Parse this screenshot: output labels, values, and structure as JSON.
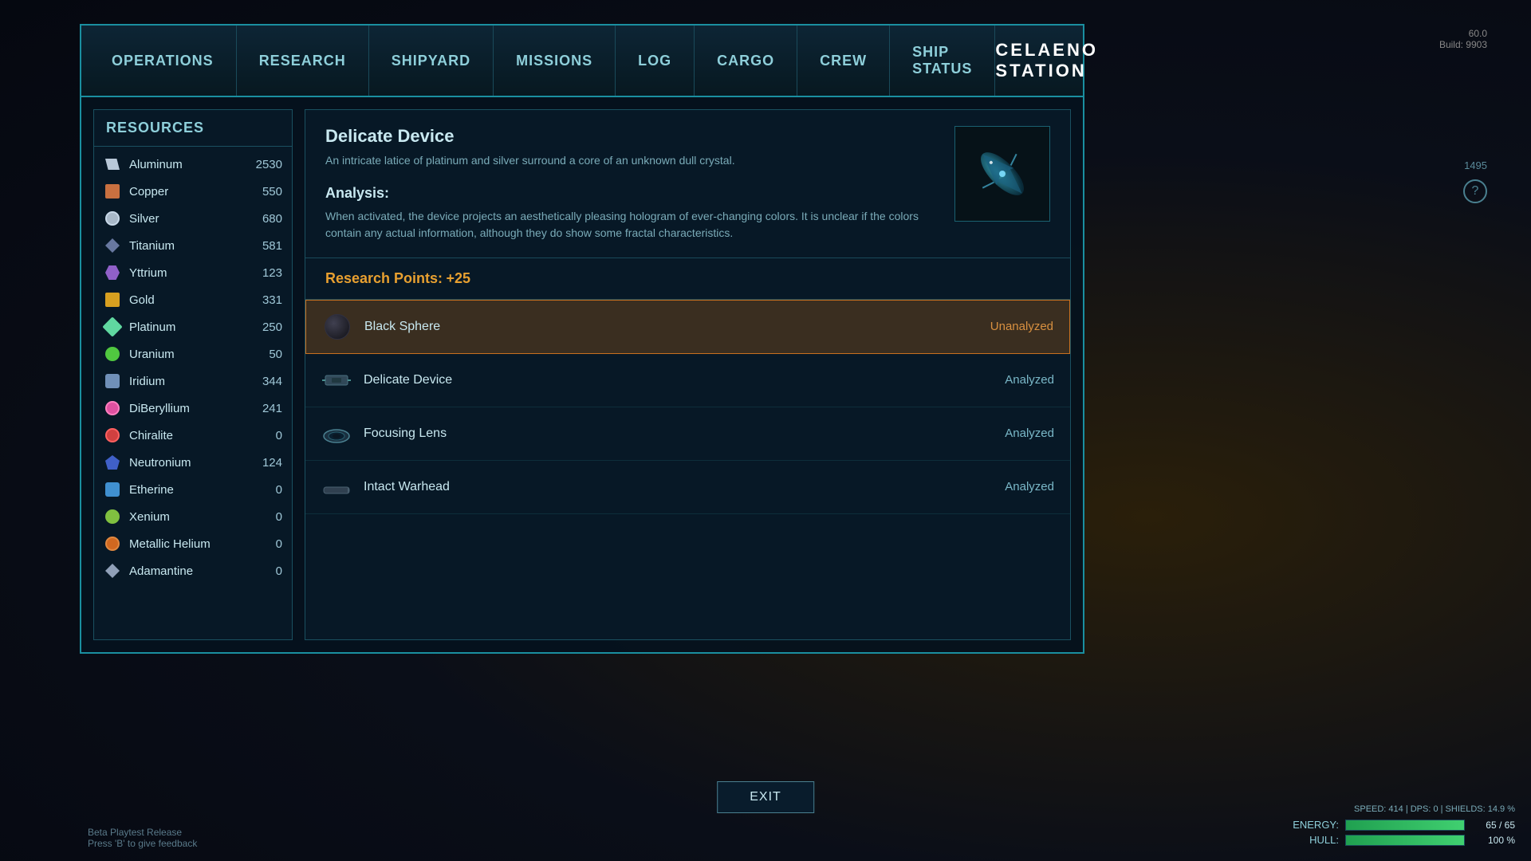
{
  "topStats": {
    "fps": "60.0",
    "build": "Build: 9903"
  },
  "nav": {
    "tabs": [
      {
        "id": "operations",
        "label": "Operations",
        "active": false
      },
      {
        "id": "research",
        "label": "Research",
        "active": false
      },
      {
        "id": "shipyard",
        "label": "Shipyard",
        "active": false
      },
      {
        "id": "missions",
        "label": "Missions",
        "active": false
      },
      {
        "id": "log",
        "label": "Log",
        "active": false
      },
      {
        "id": "cargo",
        "label": "Cargo",
        "active": false
      },
      {
        "id": "crew",
        "label": "Crew",
        "active": false
      },
      {
        "id": "ship-status",
        "label": "Ship Status",
        "active": false
      }
    ],
    "stationTitle": "CELAENO STATION"
  },
  "resources": {
    "title": "Resources",
    "items": [
      {
        "id": "aluminum",
        "name": "Aluminum",
        "amount": "2530",
        "iconClass": "icon-aluminum"
      },
      {
        "id": "copper",
        "name": "Copper",
        "amount": "550",
        "iconClass": "icon-copper"
      },
      {
        "id": "silver",
        "name": "Silver",
        "amount": "680",
        "iconClass": "icon-silver"
      },
      {
        "id": "titanium",
        "name": "Titanium",
        "amount": "581",
        "iconClass": "icon-titanium"
      },
      {
        "id": "yttrium",
        "name": "Yttrium",
        "amount": "123",
        "iconClass": "icon-yttrium"
      },
      {
        "id": "gold",
        "name": "Gold",
        "amount": "331",
        "iconClass": "icon-gold"
      },
      {
        "id": "platinum",
        "name": "Platinum",
        "amount": "250",
        "iconClass": "icon-platinum"
      },
      {
        "id": "uranium",
        "name": "Uranium",
        "amount": "50",
        "iconClass": "icon-uranium"
      },
      {
        "id": "iridium",
        "name": "Iridium",
        "amount": "344",
        "iconClass": "icon-iridium"
      },
      {
        "id": "diberyllium",
        "name": "DiBeryllium",
        "amount": "241",
        "iconClass": "icon-diberyllium"
      },
      {
        "id": "chiralite",
        "name": "Chiralite",
        "amount": "0",
        "iconClass": "icon-chiralite"
      },
      {
        "id": "neutronium",
        "name": "Neutronium",
        "amount": "124",
        "iconClass": "icon-neutronium"
      },
      {
        "id": "etherine",
        "name": "Etherine",
        "amount": "0",
        "iconClass": "icon-etherine"
      },
      {
        "id": "xenium",
        "name": "Xenium",
        "amount": "0",
        "iconClass": "icon-xenium"
      },
      {
        "id": "metallic-helium",
        "name": "Metallic Helium",
        "amount": "0",
        "iconClass": "icon-metallic-helium"
      },
      {
        "id": "adamantine",
        "name": "Adamantine",
        "amount": "0",
        "iconClass": "icon-adamantine"
      }
    ]
  },
  "itemDetail": {
    "title": "Delicate Device",
    "description": "An intricate latice of platinum and silver surround a core of an unknown dull crystal.",
    "analysisTitle": "Analysis:",
    "analysisText": "When activated, the device projects an aesthetically pleasing hologram of ever-changing colors. It is unclear if the colors contain any actual information, although they do show some fractal characteristics."
  },
  "researchPoints": {
    "label": "Research Points:",
    "value": " +25"
  },
  "listItems": [
    {
      "id": "black-sphere",
      "name": "Black Sphere",
      "status": "Unanalyzed",
      "statusClass": "status-unanalyzed",
      "selected": true
    },
    {
      "id": "delicate-device",
      "name": "Delicate Device",
      "status": "Analyzed",
      "statusClass": "status-analyzed",
      "selected": false
    },
    {
      "id": "focusing-lens",
      "name": "Focusing Lens",
      "status": "Analyzed",
      "statusClass": "status-analyzed",
      "selected": false
    },
    {
      "id": "intact-warhead",
      "name": "Intact Warhead",
      "status": "Analyzed",
      "statusClass": "status-analyzed",
      "selected": false
    }
  ],
  "exitButton": {
    "label": "Exit"
  },
  "statusBars": {
    "energy": {
      "label": "ENERGY:",
      "current": 65,
      "max": 65,
      "display": "65 / 65",
      "percent": 100
    },
    "hull": {
      "label": "HULL:",
      "current": 100,
      "max": 100,
      "display": "100 %",
      "percent": 100
    }
  },
  "betaInfo": {
    "line1": "Beta Playtest Release",
    "line2": "Press 'B' to give feedback"
  },
  "sideNumbers": {
    "top": "1495",
    "bottom": ""
  }
}
